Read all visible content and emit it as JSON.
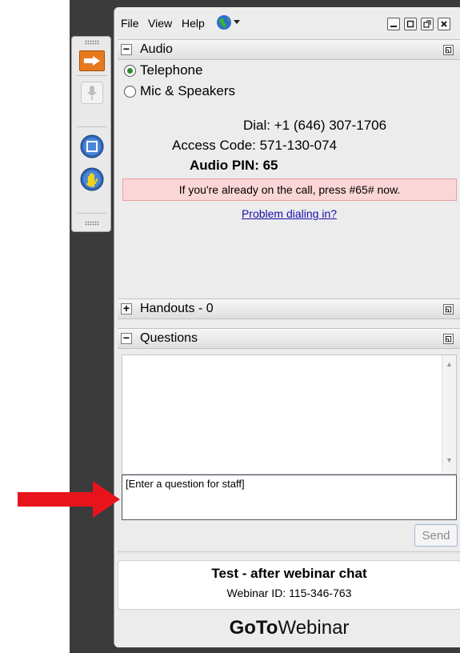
{
  "menubar": {
    "items": [
      "File",
      "View",
      "Help"
    ],
    "window_controls": [
      "minimize-icon",
      "maximize-icon",
      "popout-icon",
      "close-icon"
    ]
  },
  "grab_tab": {
    "buttons": [
      "show-panel-icon",
      "microphone-icon",
      "screen-icon",
      "raise-hand-icon"
    ]
  },
  "audio": {
    "header": "Audio",
    "toggle": "−",
    "options": [
      "Telephone",
      "Mic & Speakers"
    ],
    "selected": "Telephone",
    "dial": "Dial: +1 (646) 307-1706",
    "access_code": "Access Code: 571-130-074",
    "audio_pin": "Audio PIN: 65",
    "notice": "If you're already on the call, press #65# now.",
    "problem_link": "Problem dialing in?"
  },
  "handouts": {
    "header": "Handouts - 0",
    "toggle": "+"
  },
  "questions": {
    "header": "Questions",
    "toggle": "−",
    "placeholder": "[Enter a question for staff]",
    "send_label": "Send"
  },
  "webinar": {
    "title": "Test - after webinar chat",
    "id": "Webinar ID: 115-346-763"
  },
  "brand": {
    "bold": "GoTo",
    "light": "Webinar"
  },
  "colors": {
    "notice_bg": "#fbd6d6",
    "link": "#1a0dab",
    "arrow": "#e8141c",
    "radio_selected": "#2e8b2e"
  }
}
